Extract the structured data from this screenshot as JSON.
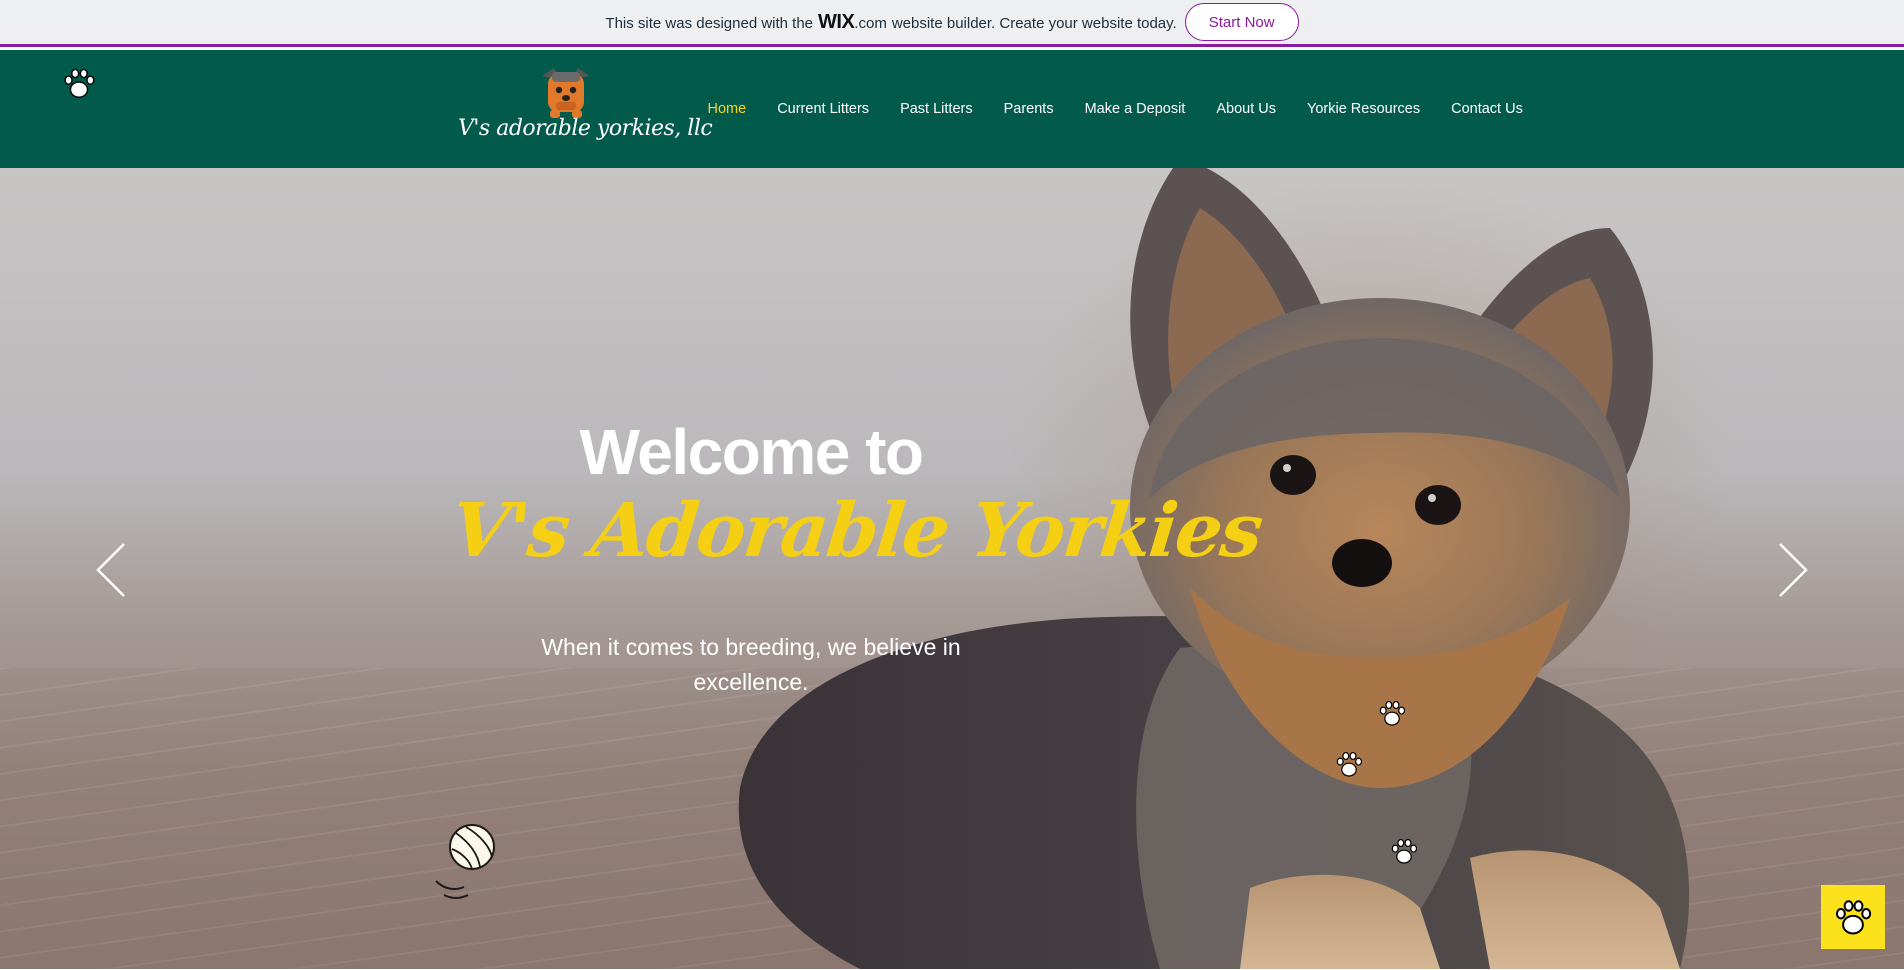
{
  "wix_banner": {
    "text_before": "This site was designed with the",
    "logo_wix": "WIX",
    "logo_com": ".com",
    "text_after": "website builder. Create your website today.",
    "button_label": "Start Now"
  },
  "header": {
    "logo_text": "V's adorable yorkies, llc",
    "nav": [
      {
        "label": "Home",
        "active": true
      },
      {
        "label": "Current Litters",
        "active": false
      },
      {
        "label": "Past Litters",
        "active": false
      },
      {
        "label": "Parents",
        "active": false
      },
      {
        "label": "Make a Deposit",
        "active": false
      },
      {
        "label": "About Us",
        "active": false
      },
      {
        "label": "Yorkie Resources",
        "active": false
      },
      {
        "label": "Contact Us",
        "active": false
      }
    ]
  },
  "hero": {
    "title": "Welcome to",
    "script_title": "V's Adorable Yorkies",
    "subtitle": "When it comes to breeding, we believe in excellence."
  },
  "colors": {
    "header_bg": "#015a4a",
    "accent_yellow": "#f5cf13",
    "wix_purple": "#8a1aa0",
    "chat_button": "#fbe21d"
  },
  "icons": {
    "header": "paw-icon",
    "carousel_prev": "chevron-left-icon",
    "carousel_next": "chevron-right-icon",
    "decoration_ball": "ball-icon",
    "chat": "paw-icon"
  }
}
